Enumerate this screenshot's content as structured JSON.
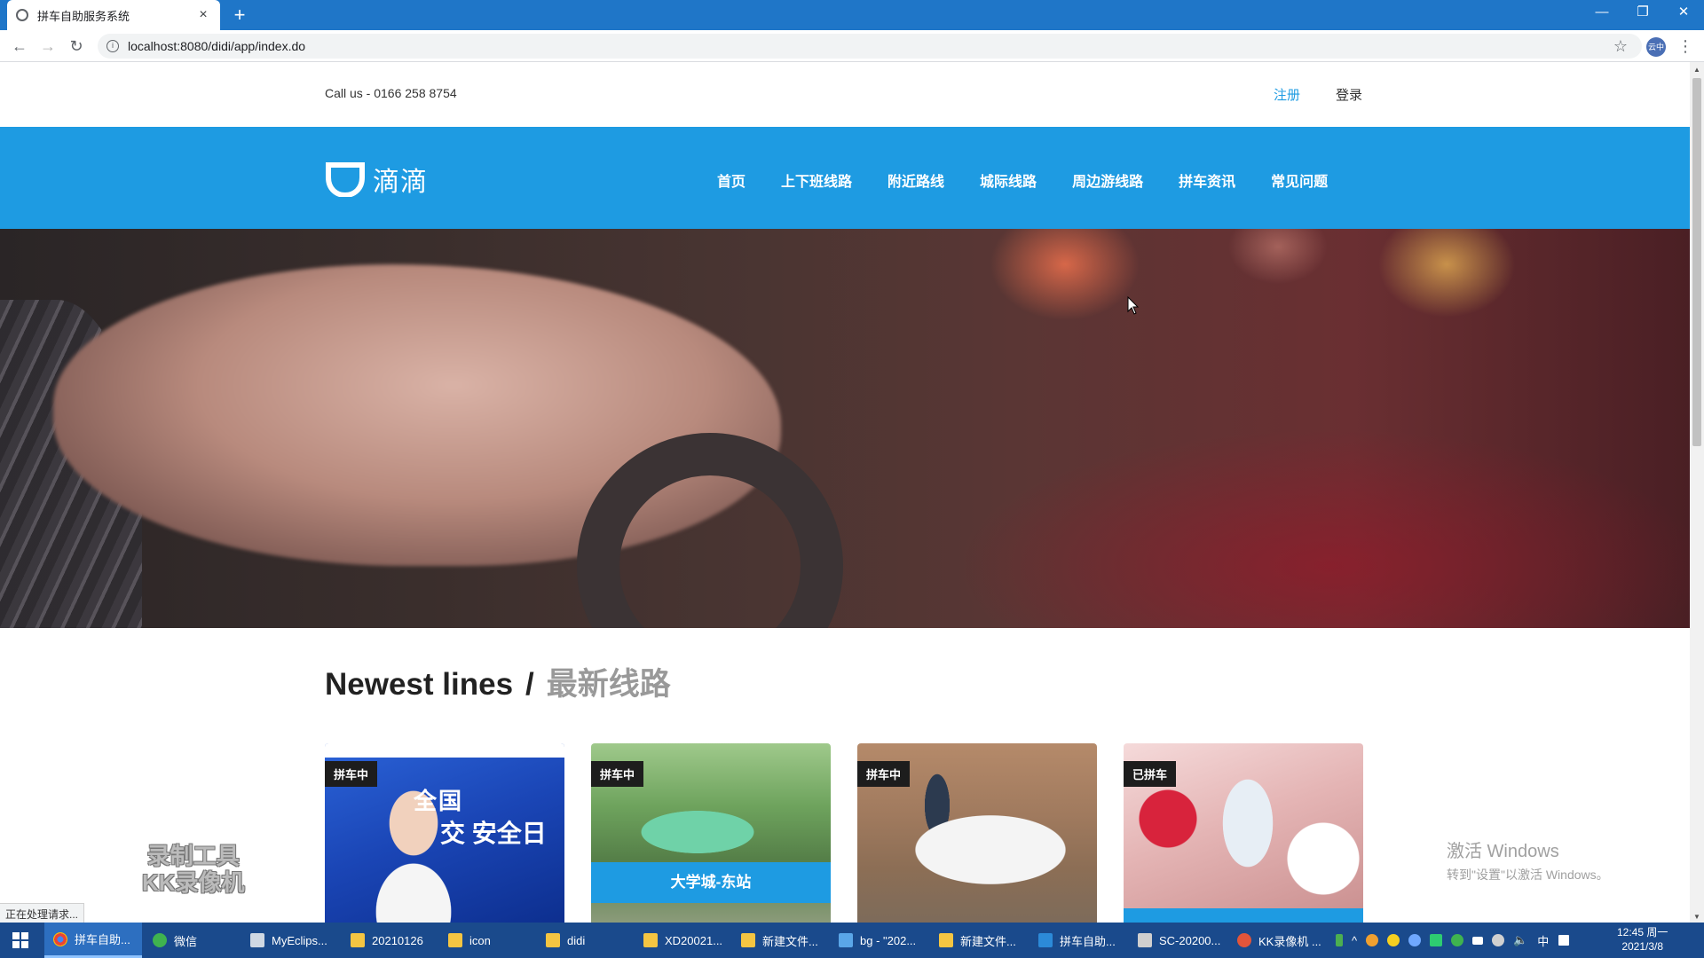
{
  "browser": {
    "tab_title": "拼车自助服务系统",
    "url": "localhost:8080/didi/app/index.do",
    "profile_label": "云中",
    "status_text": "正在处理请求..."
  },
  "header": {
    "phone": "Call us - 0166 258 8754",
    "register": "注册",
    "login": "登录"
  },
  "nav": {
    "logo_text": "滴滴",
    "items": [
      "首页",
      "上下班线路",
      "附近路线",
      "城际线路",
      "周边游线路",
      "拼车资讯",
      "常见问题"
    ]
  },
  "section": {
    "title_en": "Newest lines",
    "separator": "/",
    "title_cn": "最新线路"
  },
  "cards": [
    {
      "badge": "拼车中",
      "image_text_1": "全国",
      "image_text_2": "交  安全日"
    },
    {
      "badge": "拼车中",
      "caption": "大学城-东站"
    },
    {
      "badge": "拼车中"
    },
    {
      "badge": "已拼车"
    }
  ],
  "overlays": {
    "recorder_line1": "录制工具",
    "recorder_line2": "KK录像机",
    "activate_title": "激活 Windows",
    "activate_sub": "转到\"设置\"以激活 Windows。"
  },
  "taskbar": {
    "items": [
      "拼车自助...",
      "微信",
      "MyEclips...",
      "20210126",
      "icon",
      "didi",
      "XD20021...",
      "新建文件...",
      "bg - \"202...",
      "新建文件...",
      "拼车自助...",
      "SC-20200...",
      "KK录像机 ..."
    ],
    "ime": "中",
    "time": "12:45 周一",
    "date": "2021/3/8"
  },
  "colors": {
    "brand_blue": "#1e9be2",
    "taskbar": "#1a4a8c",
    "chrome_tabbar": "#1f76c8"
  }
}
